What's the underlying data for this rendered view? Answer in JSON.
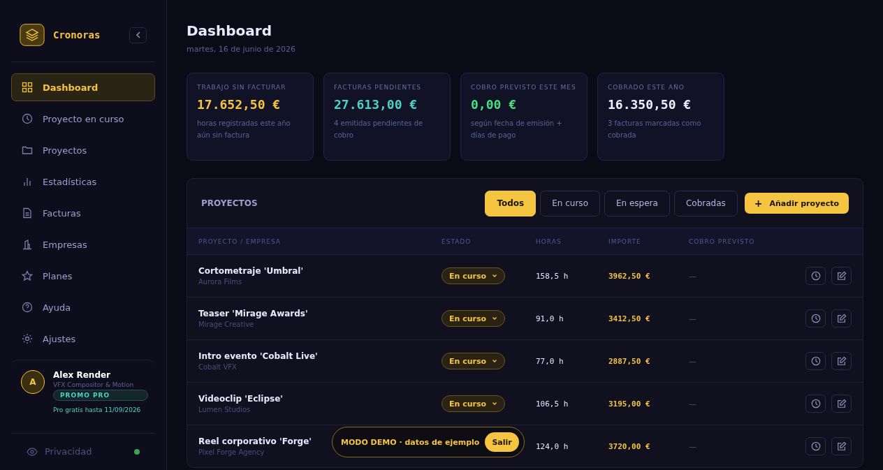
{
  "brand": {
    "name": "Cronoras"
  },
  "nav": [
    {
      "label": "Dashboard",
      "selected": true
    },
    {
      "label": "Proyecto en curso",
      "selected": false
    },
    {
      "label": "Proyectos",
      "selected": false
    },
    {
      "label": "Estadísticas",
      "selected": false
    },
    {
      "label": "Facturas",
      "selected": false
    },
    {
      "label": "Empresas",
      "selected": false
    },
    {
      "label": "Planes",
      "selected": false
    },
    {
      "label": "Ayuda",
      "selected": false
    },
    {
      "label": "Ajustes",
      "selected": false
    }
  ],
  "user": {
    "initial": "A",
    "name": "Alex Render",
    "role": "VFX Compositor & Motion",
    "badge": "PROMO PRO",
    "note": "Pro gratis hasta 11/09/2026"
  },
  "privacy": {
    "label": "Privacidad",
    "on": true
  },
  "header": {
    "title": "Dashboard",
    "date": "martes, 16 de junio de 2026"
  },
  "stats": [
    {
      "label": "TRABAJO SIN FACTURAR",
      "value": "17.652,50 €",
      "note": "horas registradas este año aún sin factura",
      "color": "#f5c542"
    },
    {
      "label": "FACTURAS PENDIENTES",
      "value": "27.613,00 €",
      "note": "4 emitidas pendientes de cobro",
      "color": "#4fd1c5"
    },
    {
      "label": "COBRO PREVISTO ESTE MES",
      "value": "0,00 €",
      "note": "según fecha de emisión + días de pago",
      "color": "#4ade80"
    },
    {
      "label": "COBRADO ESTE AÑO",
      "value": "16.350,50 €",
      "note": "3 facturas marcadas como cobrada",
      "color": "#eef0ff"
    }
  ],
  "projects": {
    "title": "PROYECTOS",
    "filters": [
      {
        "label": "Todos",
        "selected": true
      },
      {
        "label": "En curso",
        "selected": false
      },
      {
        "label": "En espera",
        "selected": false
      },
      {
        "label": "Cobradas",
        "selected": false
      }
    ],
    "add_button": {
      "icon": "+",
      "label": "Añadir proyecto"
    },
    "columns": [
      "PROYECTO / EMPRESA",
      "ESTADO",
      "HORAS",
      "IMPORTE",
      "COBRO PREVISTO"
    ],
    "rows": [
      {
        "name": "Cortometraje 'Umbral'",
        "company": "Aurora Films",
        "status": "En curso",
        "hours": "158,5 h",
        "amount": "3962,50 €",
        "due": "—"
      },
      {
        "name": "Teaser 'Mirage Awards'",
        "company": "Mirage Creative",
        "status": "En curso",
        "hours": "91,0 h",
        "amount": "3412,50 €",
        "due": "—"
      },
      {
        "name": "Intro evento 'Cobalt Live'",
        "company": "Cobalt VFX",
        "status": "En curso",
        "hours": "77,0 h",
        "amount": "2887,50 €",
        "due": "—"
      },
      {
        "name": "Videoclip 'Eclipse'",
        "company": "Lumen Studios",
        "status": "En curso",
        "hours": "106,5 h",
        "amount": "3195,00 €",
        "due": "—"
      },
      {
        "name": "Reel corporativo 'Forge'",
        "company": "Pixel Forge Agency",
        "hours": "124,0 h",
        "amount": "3720,00 €",
        "due": "—"
      }
    ]
  },
  "demo_banner": {
    "text": "MODO DEMO · datos de ejemplo",
    "button": "Salir"
  }
}
